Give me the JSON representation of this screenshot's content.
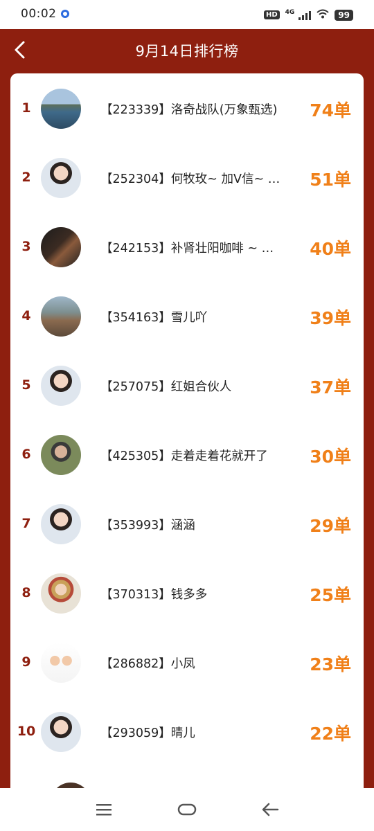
{
  "status_bar": {
    "time": "00:02",
    "hd": "HD",
    "network": "4G",
    "battery": "99"
  },
  "header": {
    "title": "9月14日排行榜"
  },
  "colors": {
    "brand": "#8e1f0f",
    "orders": "#f08019"
  },
  "rankings": [
    {
      "rank": "1",
      "name": "【223339】洛奇战队(万象甄选)",
      "orders": "74单",
      "avatar": "coast-photo"
    },
    {
      "rank": "2",
      "name": "【252304】何牧玫~ 加V信~ …",
      "orders": "51单",
      "avatar": "woman-portrait"
    },
    {
      "rank": "3",
      "name": "【242153】补肾壮阳咖啡 ~ …",
      "orders": "40单",
      "avatar": "poster-photo"
    },
    {
      "rank": "4",
      "name": "【354163】雪儿吖",
      "orders": "39单",
      "avatar": "beach-child-photo"
    },
    {
      "rank": "5",
      "name": "【257075】红姐合伙人",
      "orders": "37单",
      "avatar": "woman-portrait"
    },
    {
      "rank": "6",
      "name": "【425305】走着走着花就开了",
      "orders": "30单",
      "avatar": "outdoor-woman-photo"
    },
    {
      "rank": "7",
      "name": "【353993】涵涵",
      "orders": "29单",
      "avatar": "woman-portrait"
    },
    {
      "rank": "8",
      "name": "【370313】钱多多",
      "orders": "25单",
      "avatar": "woman-hat-photo"
    },
    {
      "rank": "9",
      "name": "【286882】小凤",
      "orders": "23单",
      "avatar": "cartoon-family"
    },
    {
      "rank": "10",
      "name": "【293059】晴儿",
      "orders": "22单",
      "avatar": "woman-portrait"
    }
  ]
}
